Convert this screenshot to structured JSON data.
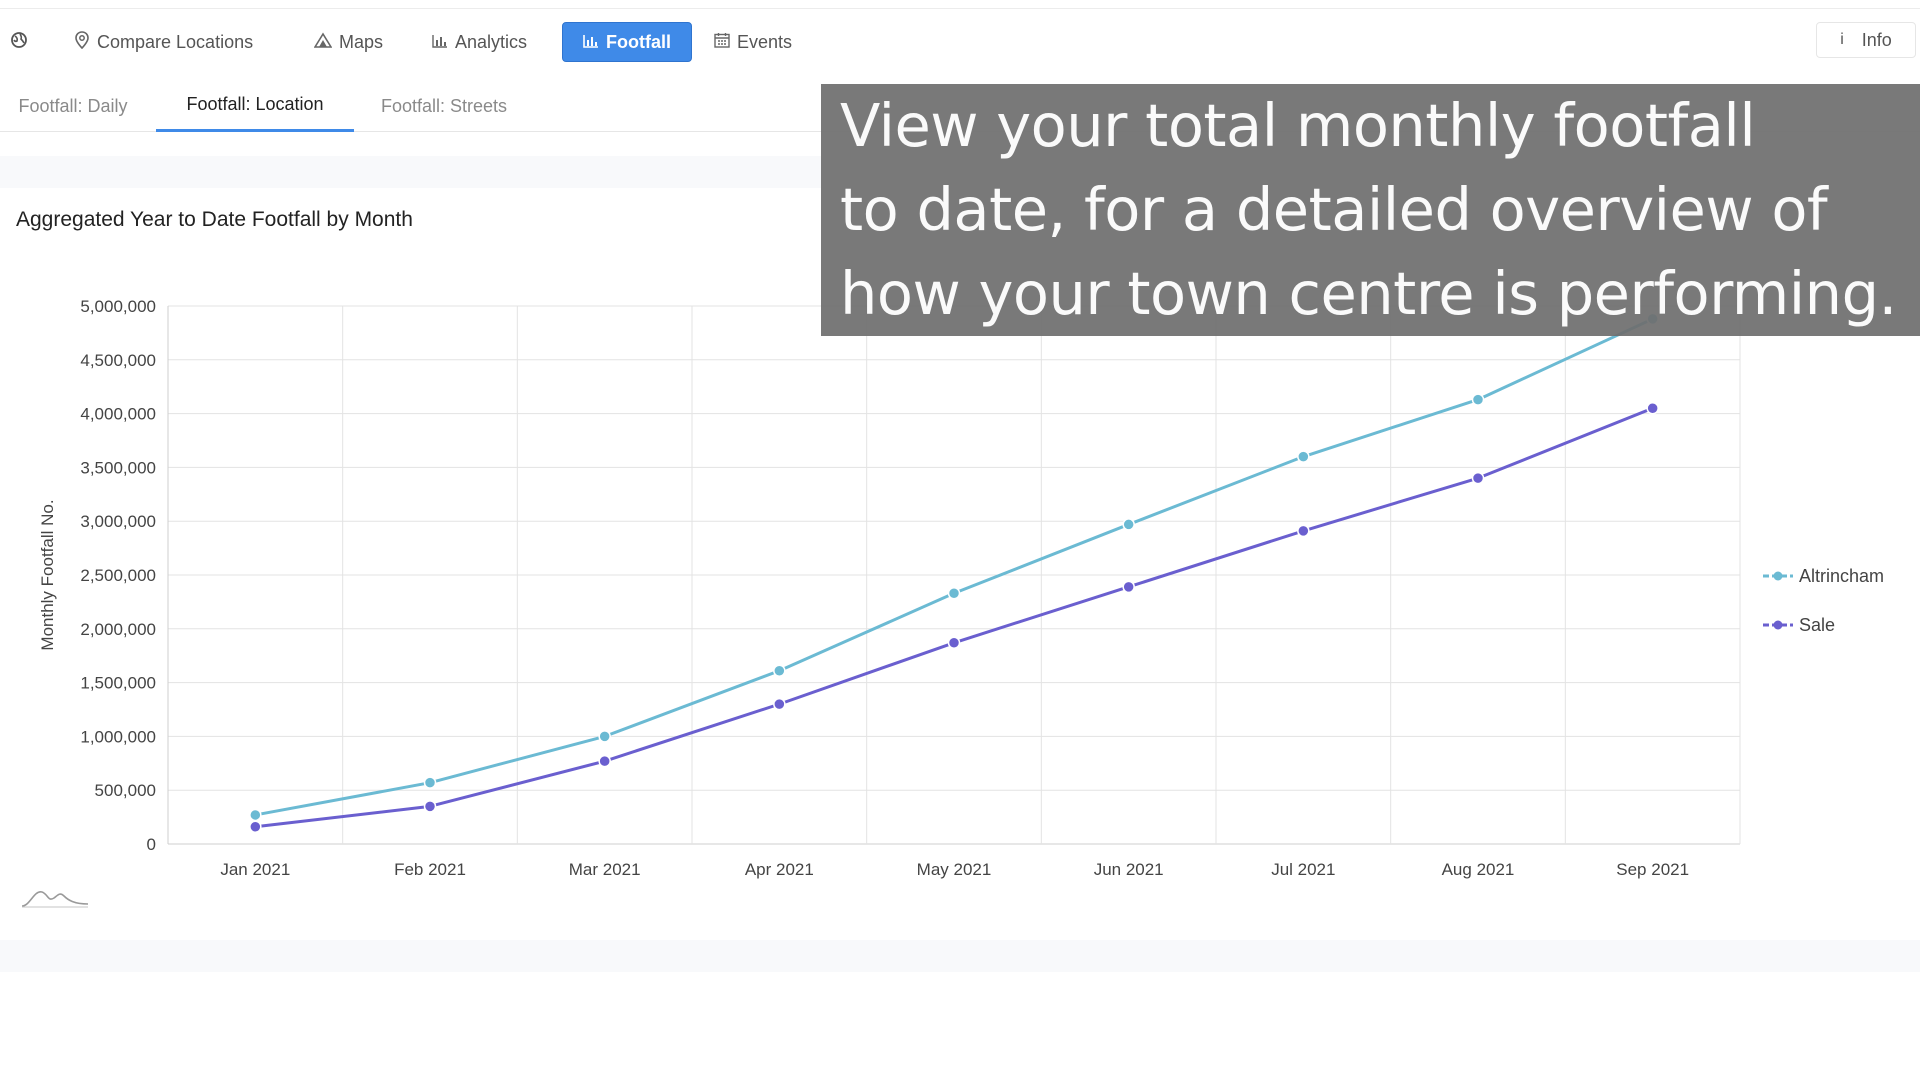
{
  "nav": {
    "items": [
      {
        "label": "Compare Locations",
        "icon": "map-pin-icon",
        "active": false
      },
      {
        "label": "Maps",
        "icon": "mountain-icon",
        "active": false
      },
      {
        "label": "Analytics",
        "icon": "bar-chart-icon",
        "active": false
      },
      {
        "label": "Footfall",
        "icon": "bar-chart-icon",
        "active": true
      },
      {
        "label": "Events",
        "icon": "calendar-icon",
        "active": false
      }
    ],
    "info_label": "Info",
    "info_icon": "info-icon"
  },
  "subtabs": [
    {
      "label": "Footfall: Daily",
      "active": false
    },
    {
      "label": "Footfall: Location",
      "active": true
    },
    {
      "label": "Footfall: Streets",
      "active": false
    }
  ],
  "panel": {
    "title": "Aggregated Year to Date Footfall by Month"
  },
  "overlay": {
    "lines": [
      "View your total monthly footfall",
      "to date, for a detailed overview of",
      "how your town centre is performing."
    ]
  },
  "colors": {
    "accent": "#3f8ae8",
    "altrincham": "#6bbad3",
    "sale": "#6a5fcf"
  },
  "chart_data": {
    "type": "line",
    "title": "",
    "xlabel": "",
    "ylabel": "Monthly Footfall No.",
    "categories": [
      "Jan 2021",
      "Feb 2021",
      "Mar 2021",
      "Apr 2021",
      "May 2021",
      "Jun 2021",
      "Jul 2021",
      "Aug 2021",
      "Sep 2021"
    ],
    "yticks": [
      "0",
      "500,000",
      "1,000,000",
      "1,500,000",
      "2,000,000",
      "2,500,000",
      "3,000,000",
      "3,500,000",
      "4,000,000",
      "4,500,000",
      "5,000,000"
    ],
    "ylim": [
      0,
      5000000
    ],
    "grid": true,
    "legend_position": "right",
    "series": [
      {
        "name": "Altrincham",
        "color": "#6bbad3",
        "values": [
          270000,
          570000,
          1000000,
          1610000,
          2330000,
          2970000,
          3600000,
          4130000,
          4880000
        ]
      },
      {
        "name": "Sale",
        "color": "#6a5fcf",
        "values": [
          160000,
          350000,
          770000,
          1300000,
          1870000,
          2390000,
          2910000,
          3400000,
          4050000
        ]
      }
    ]
  }
}
